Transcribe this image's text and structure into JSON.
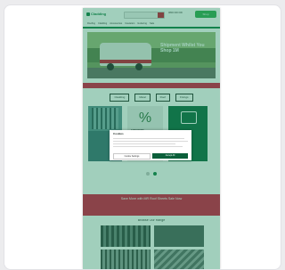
{
  "header": {
    "logo_text": "Cladding",
    "search_placeholder": "Search",
    "phone": "0800 000 000",
    "shop_button": "Shop"
  },
  "nav": {
    "items": [
      "Roofing",
      "Cladding",
      "Accessories",
      "Insulation",
      "Guttering",
      "Sale"
    ]
  },
  "hero": {
    "headline": "Shipment Whilst You Shop 1M"
  },
  "categories": [
    "Cladding",
    "Metal",
    "Roof",
    "Fixings"
  ],
  "feature_cards": [
    {
      "title": ""
    },
    {
      "title": "Discount",
      "body": ""
    },
    {
      "title": ""
    }
  ],
  "promo_band": {
    "text": "Save More with MR Roof Sheets Sale Now"
  },
  "products_section": {
    "title": "Browse Our Range"
  },
  "cookie_dialog": {
    "title": "Cookies",
    "body": "",
    "settings_label": "Cookie Settings",
    "accept_label": "Accept All"
  },
  "colors": {
    "brand_green": "#0b7a3e",
    "brand_red": "#d70f3a",
    "overlay": "#1e8c5f"
  }
}
